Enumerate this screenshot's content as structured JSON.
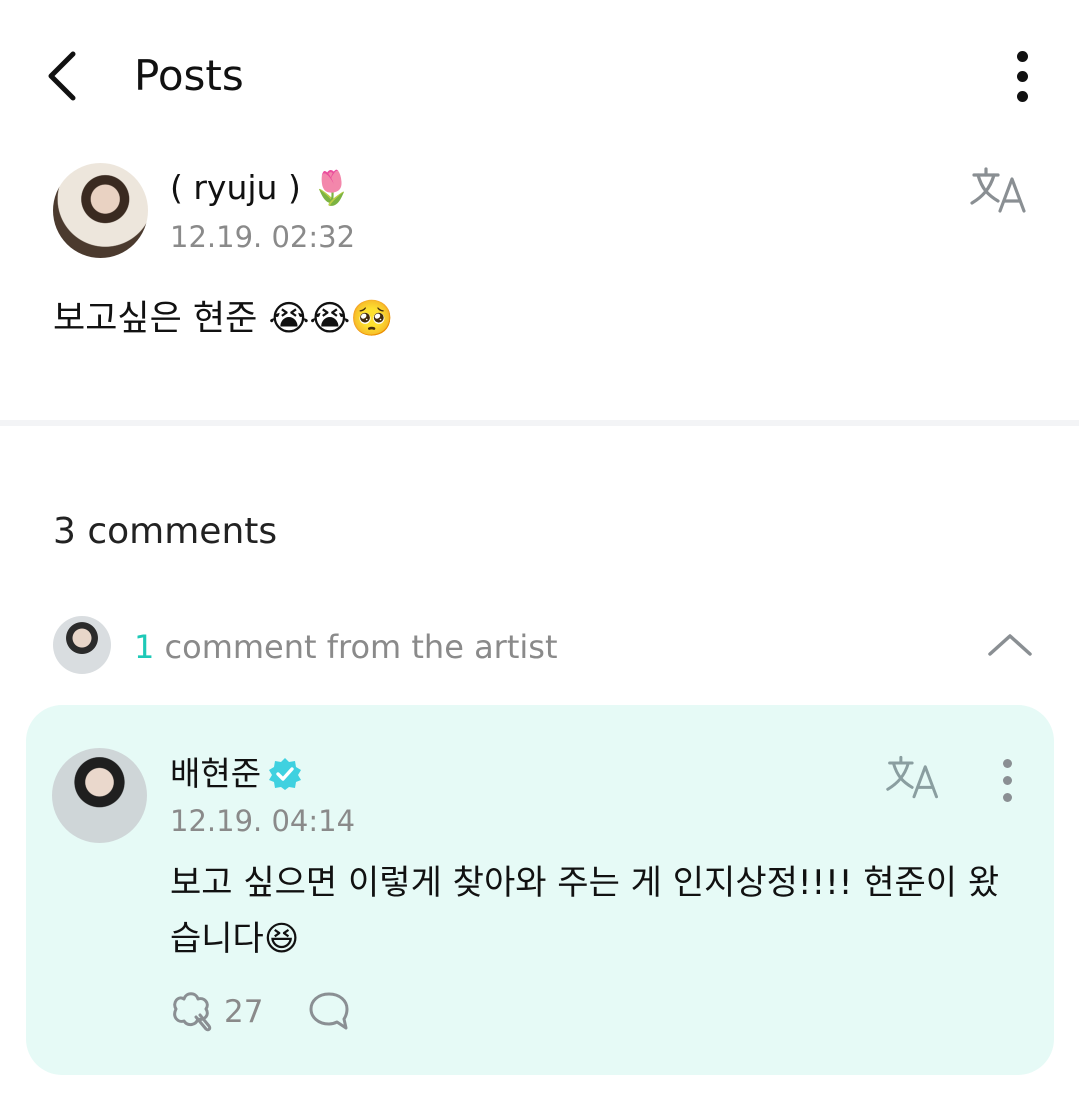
{
  "header": {
    "title": "Posts"
  },
  "post": {
    "author": "( ryuju ) 🌷",
    "time": "12.19. 02:32",
    "body": "보고싶은 현준 😭😭🥺"
  },
  "comments": {
    "count_label": "3 comments",
    "artist_summary": {
      "count": "1",
      "text": " comment from the artist"
    },
    "artist_comment": {
      "name": "배현준",
      "time": "12.19. 04:14",
      "body": "보고 싶으면 이렇게 찾아와 주는 게 인지상정!!!! 현준이 왔습니다😆",
      "likes": "27"
    }
  },
  "colors": {
    "accent": "#1ec9b7",
    "card_bg": "#e6faf6",
    "verified": "#3fd1e0"
  }
}
